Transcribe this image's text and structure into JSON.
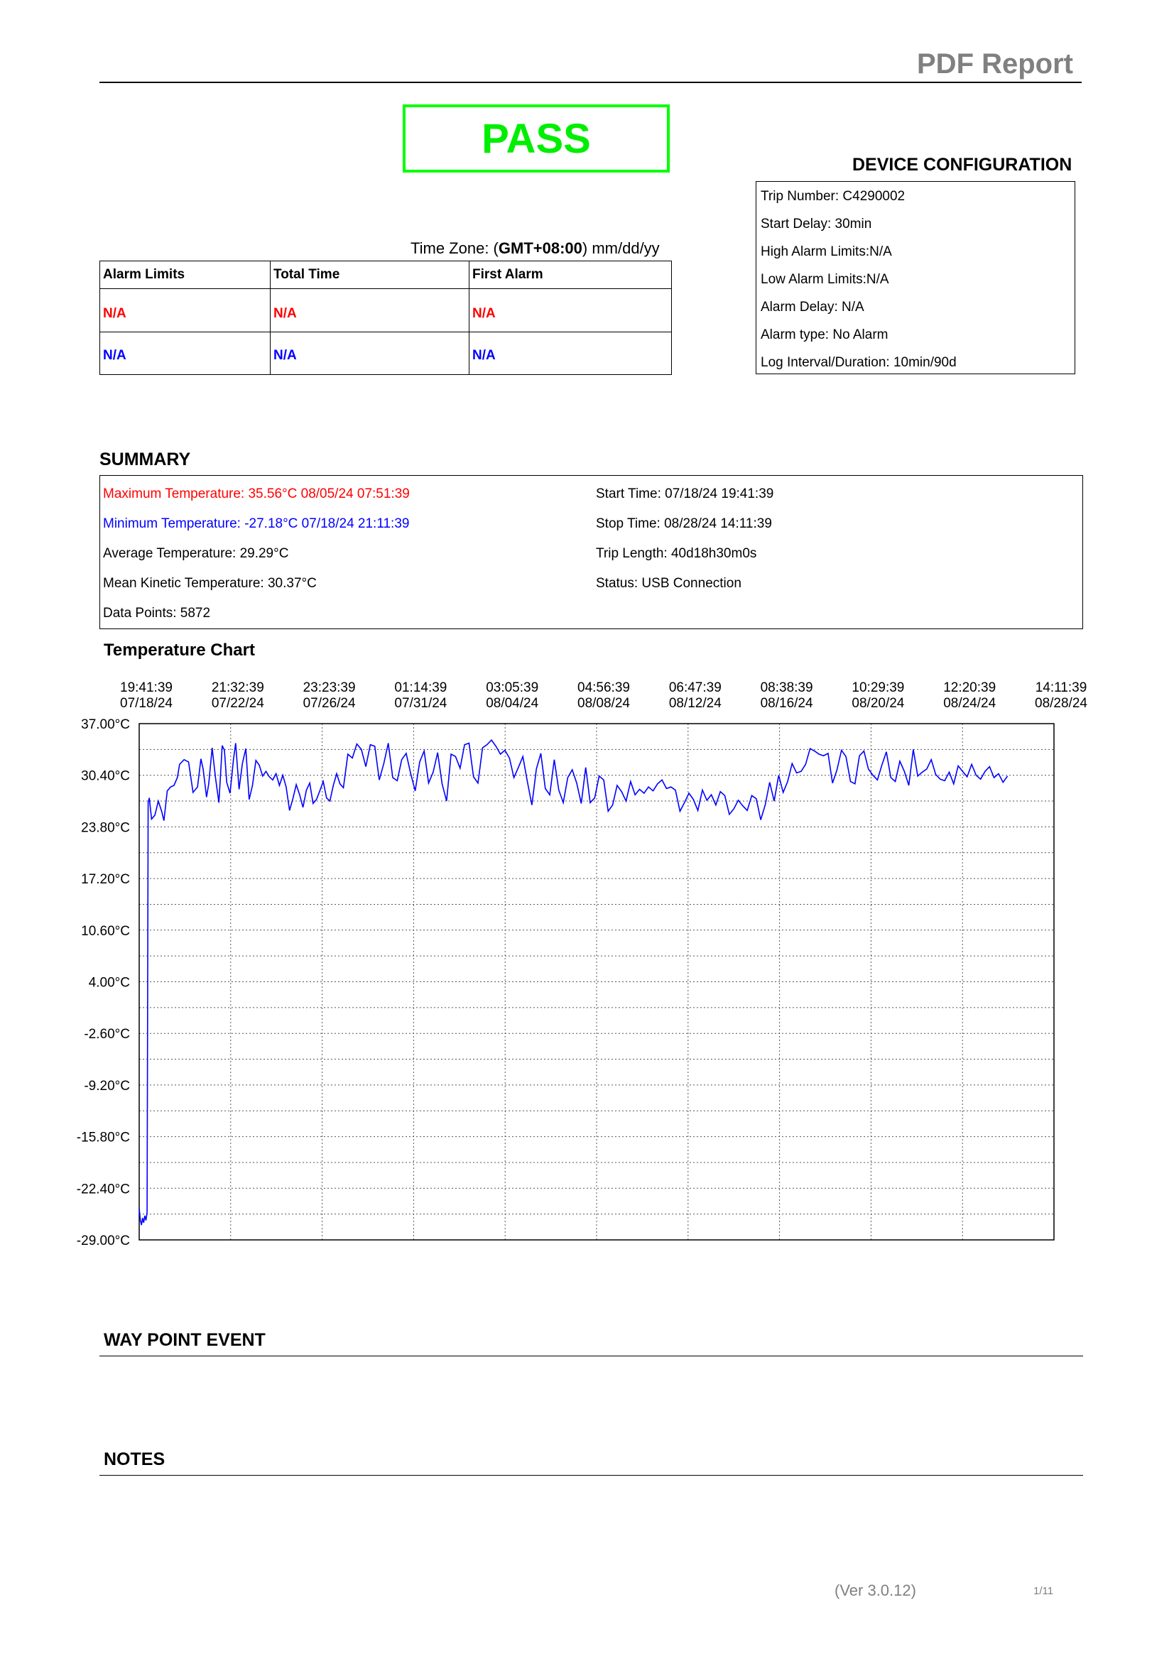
{
  "header": {
    "title": "PDF Report"
  },
  "result": {
    "label": "PASS",
    "color": "#00ff00"
  },
  "timezone": {
    "prefix": "Time Zone: (",
    "zone": "GMT+08:00",
    "suffix": ") mm/dd/yy"
  },
  "alarm_table": {
    "headers": [
      "Alarm Limits",
      "Total Time",
      "First Alarm"
    ],
    "rows": [
      {
        "color": "#ff0000",
        "cells": [
          "N/A",
          "N/A",
          "N/A"
        ]
      },
      {
        "color": "#0000ff",
        "cells": [
          "N/A",
          "N/A",
          "N/A"
        ]
      }
    ]
  },
  "device_configuration": {
    "heading": "DEVICE CONFIGURATION",
    "lines": [
      "Trip Number: C4290002",
      "Start Delay:  30min",
      "High Alarm Limits:N/A",
      "Low Alarm Limits:N/A",
      "Alarm Delay:  N/A",
      "Alarm type:  No Alarm",
      "Log Interval/Duration: 10min/90d"
    ]
  },
  "summary": {
    "heading": "SUMMARY",
    "left": [
      {
        "text": "Maximum Temperature: 35.56°C  08/05/24 07:51:39",
        "color": "#ff0000"
      },
      {
        "text": "Minimum Temperature: -27.18°C  07/18/24 21:11:39",
        "color": "#0000ff"
      },
      {
        "text": "Average Temperature: 29.29°C",
        "color": "#000000"
      },
      {
        "text": "Mean Kinetic Temperature: 30.37°C",
        "color": "#000000"
      },
      {
        "text": "Data Points: 5872",
        "color": "#000000"
      }
    ],
    "right": [
      "Start Time: 07/18/24 19:41:39",
      "Stop Time: 08/28/24 14:11:39",
      "Trip Length: 40d18h30m0s",
      "Status: USB Connection"
    ]
  },
  "chart_data": {
    "type": "line",
    "title": "Temperature Chart",
    "x_ticks": [
      {
        "time": "19:41:39",
        "date": "07/18/24"
      },
      {
        "time": "21:32:39",
        "date": "07/22/24"
      },
      {
        "time": "23:23:39",
        "date": "07/26/24"
      },
      {
        "time": "01:14:39",
        "date": "07/31/24"
      },
      {
        "time": "03:05:39",
        "date": "08/04/24"
      },
      {
        "time": "04:56:39",
        "date": "08/08/24"
      },
      {
        "time": "06:47:39",
        "date": "08/12/24"
      },
      {
        "time": "08:38:39",
        "date": "08/16/24"
      },
      {
        "time": "10:29:39",
        "date": "08/20/24"
      },
      {
        "time": "12:20:39",
        "date": "08/24/24"
      },
      {
        "time": "14:11:39",
        "date": "08/28/24"
      }
    ],
    "y_ticks": [
      "37.00°C",
      "30.40°C",
      "23.80°C",
      "17.20°C",
      "10.60°C",
      "4.00°C",
      "-2.60°C",
      "-9.20°C",
      "-15.80°C",
      "-22.40°C",
      "-29.00°C"
    ],
    "ylim": [
      -29.0,
      37.0
    ],
    "grid": true,
    "line_color": "#0000ff",
    "series": [
      {
        "x_days": [
          0,
          0.05,
          0.1,
          0.15,
          0.2,
          0.25,
          0.3,
          0.35,
          0.4,
          0.45,
          0.55,
          0.7,
          0.85,
          1.0,
          1.1,
          1.25,
          1.4,
          1.55,
          1.7,
          1.8,
          2.0,
          2.2,
          2.4,
          2.6,
          2.75,
          2.85,
          3.0,
          3.1,
          3.25,
          3.4,
          3.55,
          3.7,
          3.8,
          3.9,
          4.05,
          4.2,
          4.3,
          4.45,
          4.6,
          4.75,
          4.9,
          5.05,
          5.2,
          5.35,
          5.5,
          5.65,
          5.8,
          5.95,
          6.1,
          6.25,
          6.4,
          6.55,
          6.7,
          6.85,
          7.0,
          7.15,
          7.3,
          7.45,
          7.6,
          7.75,
          7.9,
          8.05,
          8.2,
          8.35,
          8.5,
          8.65,
          8.8,
          8.95,
          9.1,
          9.3,
          9.5,
          9.7,
          9.9,
          10.1,
          10.3,
          10.5,
          10.7,
          10.9,
          11.1,
          11.3,
          11.5,
          11.7,
          11.9,
          12.1,
          12.3,
          12.5,
          12.7,
          12.9,
          13.1,
          13.3,
          13.5,
          13.7,
          13.9,
          14.1,
          14.3,
          14.5,
          14.7,
          14.9,
          15.1,
          15.3,
          15.5,
          15.7,
          15.9,
          16.1,
          16.3,
          16.5,
          16.7,
          16.9,
          17.1,
          17.3,
          17.5,
          17.7,
          17.9,
          18.1,
          18.3,
          18.5,
          18.7,
          18.9,
          19.1,
          19.3,
          19.5,
          19.7,
          19.9,
          20.1,
          20.3,
          20.5,
          20.7,
          20.9,
          21.1,
          21.3,
          21.5,
          21.7,
          21.9,
          22.1,
          22.3,
          22.5,
          22.7,
          22.9,
          23.1,
          23.3,
          23.5,
          23.7,
          23.9,
          24.1,
          24.3,
          24.5,
          24.7,
          24.9,
          25.1,
          25.3,
          25.5,
          25.7,
          25.9,
          26.1,
          26.3,
          26.5,
          26.7,
          26.9,
          27.1,
          27.3,
          27.5,
          27.7,
          27.9,
          28.1,
          28.3,
          28.5,
          28.7,
          28.9,
          29.1,
          29.3,
          29.5,
          29.7,
          29.9,
          30.1,
          30.3,
          30.5,
          30.7,
          30.9,
          31.1,
          31.3,
          31.5,
          31.7,
          31.9,
          32.1,
          32.3,
          32.5,
          32.7,
          32.9,
          33.1,
          33.3,
          33.5,
          33.7,
          33.9,
          34.1,
          34.3,
          34.5,
          34.7,
          34.9,
          35.1,
          35.3,
          35.5,
          35.7,
          35.9,
          36.1,
          36.3,
          36.5,
          36.7,
          36.9,
          37.1,
          37.3,
          37.5,
          37.7,
          37.9,
          38.1,
          38.3,
          38.5,
          38.7,
          38.9,
          39.1,
          39.3,
          39.5,
          39.7,
          39.9,
          40.1,
          40.3,
          40.5,
          40.77
        ],
        "values": [
          -25,
          -26.5,
          -27.1,
          -26.2,
          -26.8,
          -25.9,
          -26.5,
          -25.5,
          26.9,
          27.5,
          24.8,
          25.3,
          27.1,
          25.8,
          24.6,
          28.4,
          28.9,
          29.1,
          30.1,
          31.8,
          32.4,
          32.1,
          28.2,
          28.9,
          32.5,
          31.2,
          27.6,
          29.3,
          33.9,
          30.1,
          26.9,
          34.2,
          33.6,
          29.5,
          28.1,
          32.4,
          34.5,
          28.6,
          31.9,
          33.8,
          27.3,
          29.1,
          32.3,
          31.7,
          30.3,
          30.9,
          30.2,
          29.8,
          30.6,
          29.1,
          30.4,
          28.9,
          25.9,
          27.4,
          29.2,
          27.9,
          26.3,
          28.5,
          29.4,
          26.8,
          27.3,
          28.4,
          29.6,
          27.5,
          27.1,
          29.1,
          30.6,
          29.3,
          28.8,
          33.1,
          32.6,
          34.4,
          33.7,
          31.5,
          34.3,
          34.1,
          29.8,
          31.9,
          34.5,
          30.1,
          29.7,
          32.4,
          33.2,
          30.6,
          28.4,
          32.1,
          33.5,
          29.4,
          30.8,
          33.3,
          29.3,
          27.1,
          33.1,
          32.8,
          31.3,
          34.3,
          34.5,
          30.2,
          29.4,
          33.9,
          34.3,
          34.9,
          34.1,
          33.1,
          33.6,
          32.6,
          30.1,
          31.4,
          32.8,
          29.6,
          26.6,
          31.2,
          33.2,
          28.7,
          27.9,
          32.4,
          28.5,
          26.9,
          30.1,
          31.1,
          29.4,
          26.8,
          31.4,
          26.9,
          27.5,
          30.3,
          29.8,
          25.8,
          26.6,
          29.1,
          28.3,
          27.1,
          29.6,
          27.9,
          28.6,
          28.1,
          28.9,
          28.4,
          29.3,
          29.8,
          28.7,
          28.9,
          28.5,
          25.8,
          26.9,
          28.1,
          27.3,
          25.9,
          28.5,
          27.2,
          27.9,
          26.6,
          28.3,
          27.8,
          25.4,
          26.1,
          27.2,
          26.5,
          25.9,
          27.8,
          27.4,
          24.7,
          26.6,
          29.5,
          27.1,
          30.4,
          28.2,
          29.6,
          31.9,
          30.7,
          30.9,
          31.8,
          33.8,
          33.5,
          33.1,
          32.9,
          33.2,
          29.4,
          31.1,
          33.6,
          32.8,
          29.6,
          29.3,
          32.9,
          33.5,
          31.2,
          30.4,
          29.8,
          31.7,
          33.4,
          30.1,
          29.6,
          32.2,
          30.9,
          29.1,
          33.7,
          30.3,
          30.8,
          31.2,
          32.4,
          30.5,
          29.9,
          29.7,
          30.8,
          29.3,
          31.6,
          30.9,
          30.2,
          31.8,
          30.4,
          29.9,
          30.9,
          31.5,
          30.1,
          30.6,
          29.5,
          30.3
        ]
      }
    ]
  },
  "way_point": {
    "heading": "WAY POINT EVENT"
  },
  "notes": {
    "heading": "NOTES"
  },
  "footer": {
    "version": "(Ver 3.0.12)",
    "page": "1/11"
  }
}
